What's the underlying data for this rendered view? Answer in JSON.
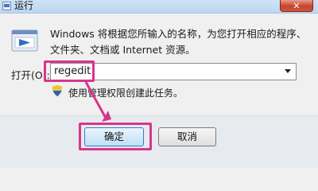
{
  "window": {
    "title": "运行",
    "close_glyph": "✕"
  },
  "description": "Windows 将根据您所输入的名称，为您打开相应的程序、文件夹、文档或 Internet 资源。",
  "open_label": "打开(O):",
  "command_input": {
    "value": "regedit"
  },
  "admin_note": "使用管理权限创建此任务。",
  "buttons": {
    "ok": "确定",
    "cancel": "取消"
  },
  "icons": {
    "run": "run-icon",
    "shield": "shield-icon",
    "dropdown": "chevron-down-icon",
    "close": "close-icon"
  },
  "colors": {
    "highlight": "#d6368b",
    "title_bar": "#cfe3f7",
    "close_button": "#c7432b"
  }
}
